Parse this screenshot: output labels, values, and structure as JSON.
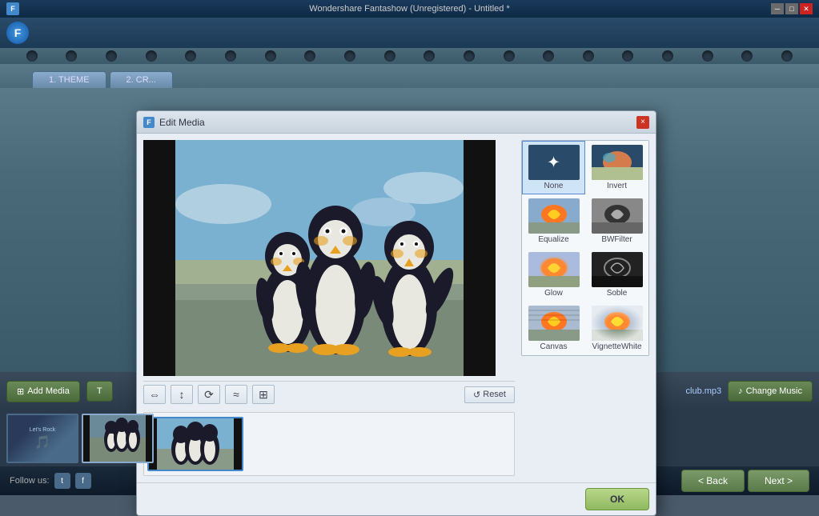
{
  "app": {
    "title": "Wondershare Fantashow (Unregistered) - Untitled *",
    "logo_letter": "F"
  },
  "tabs": [
    {
      "id": "theme",
      "label": "1. THEME",
      "active": false
    },
    {
      "id": "create",
      "label": "2. CR...",
      "active": false
    }
  ],
  "modal": {
    "title": "Edit Media",
    "close_label": "×",
    "reset_label": "↺ Reset",
    "ok_label": "OK",
    "tools": [
      {
        "id": "tool1",
        "symbol": "⇔",
        "label": "flip-horizontal"
      },
      {
        "id": "tool2",
        "symbol": "⇕",
        "label": "flip-vertical"
      },
      {
        "id": "tool3",
        "symbol": "⟺",
        "label": "rotate"
      },
      {
        "id": "tool4",
        "symbol": "⥊",
        "label": "adjust"
      },
      {
        "id": "tool5",
        "symbol": "⬜",
        "label": "crop"
      }
    ],
    "filters": [
      {
        "id": "none",
        "label": "None",
        "selected": true,
        "type": "none"
      },
      {
        "id": "invert",
        "label": "Invert",
        "selected": false,
        "type": "invert"
      },
      {
        "id": "equalize",
        "label": "Equalize",
        "selected": false,
        "type": "balloon"
      },
      {
        "id": "bwfilter",
        "label": "BWFilter",
        "selected": false,
        "type": "balloon2"
      },
      {
        "id": "glow",
        "label": "Glow",
        "selected": false,
        "type": "glow"
      },
      {
        "id": "soble",
        "label": "Soble",
        "selected": false,
        "type": "soble"
      },
      {
        "id": "canvas",
        "label": "Canvas",
        "selected": false,
        "type": "canvas"
      },
      {
        "id": "vignettewhite",
        "label": "VignetteWhite",
        "selected": false,
        "type": "vigwhite"
      }
    ]
  },
  "toolbar": {
    "add_media_label": "Add Media",
    "t_label": "T",
    "music_label": "club.mp3",
    "change_music_label": "Change Music"
  },
  "footer": {
    "follow_label": "Follow us:",
    "back_label": "< Back",
    "next_label": "Next >"
  }
}
